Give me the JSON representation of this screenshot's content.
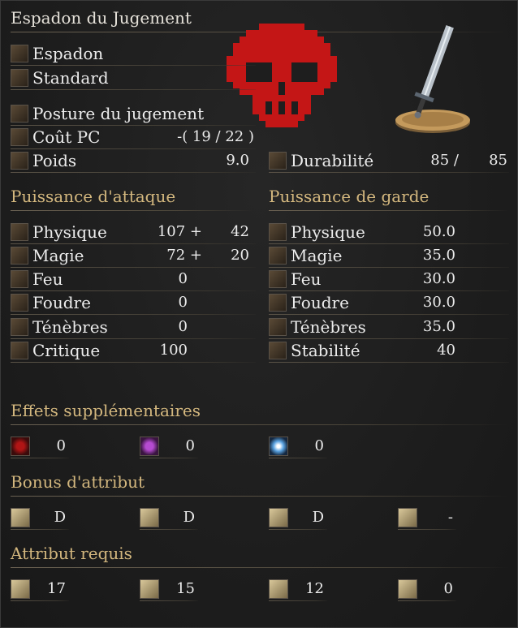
{
  "weapon": {
    "name": "Espadon du Jugement"
  },
  "info": {
    "type": "Espadon",
    "attack": "Standard",
    "skill": "Posture du jugement",
    "fp_label": "Coût PC",
    "fp_value": "-( 19 / 22 )",
    "weight_label": "Poids",
    "weight_value": "9.0",
    "durability_label": "Durabilité",
    "durability_cur": "85 /",
    "durability_max": "85"
  },
  "attack_power": {
    "title": "Puissance d'attaque",
    "rows": [
      {
        "label": "Physique",
        "base": "107 +",
        "bonus": "42"
      },
      {
        "label": "Magie",
        "base": "72 +",
        "bonus": "20"
      },
      {
        "label": "Feu",
        "base": "0",
        "bonus": ""
      },
      {
        "label": "Foudre",
        "base": "0",
        "bonus": ""
      },
      {
        "label": "Ténèbres",
        "base": "0",
        "bonus": ""
      },
      {
        "label": "Critique",
        "base": "100",
        "bonus": ""
      }
    ]
  },
  "guard": {
    "title": "Puissance de garde",
    "rows": [
      {
        "label": "Physique",
        "value": "50.0"
      },
      {
        "label": "Magie",
        "value": "35.0"
      },
      {
        "label": "Feu",
        "value": "30.0"
      },
      {
        "label": "Foudre",
        "value": "30.0"
      },
      {
        "label": "Ténèbres",
        "value": "35.0"
      },
      {
        "label": "Stabilité",
        "value": "40"
      }
    ]
  },
  "effects": {
    "title": "Effets supplémentaires",
    "values": [
      "0",
      "0",
      "0"
    ]
  },
  "bonus": {
    "title": "Bonus d'attribut",
    "values": [
      "D",
      "D",
      "D",
      "-"
    ]
  },
  "requirements": {
    "title": "Attribut requis",
    "values": [
      "17",
      "15",
      "12",
      "0"
    ]
  },
  "colors": {
    "accent": "#d3b77e",
    "skull": "#c41616",
    "background": "#1e1e1e"
  }
}
